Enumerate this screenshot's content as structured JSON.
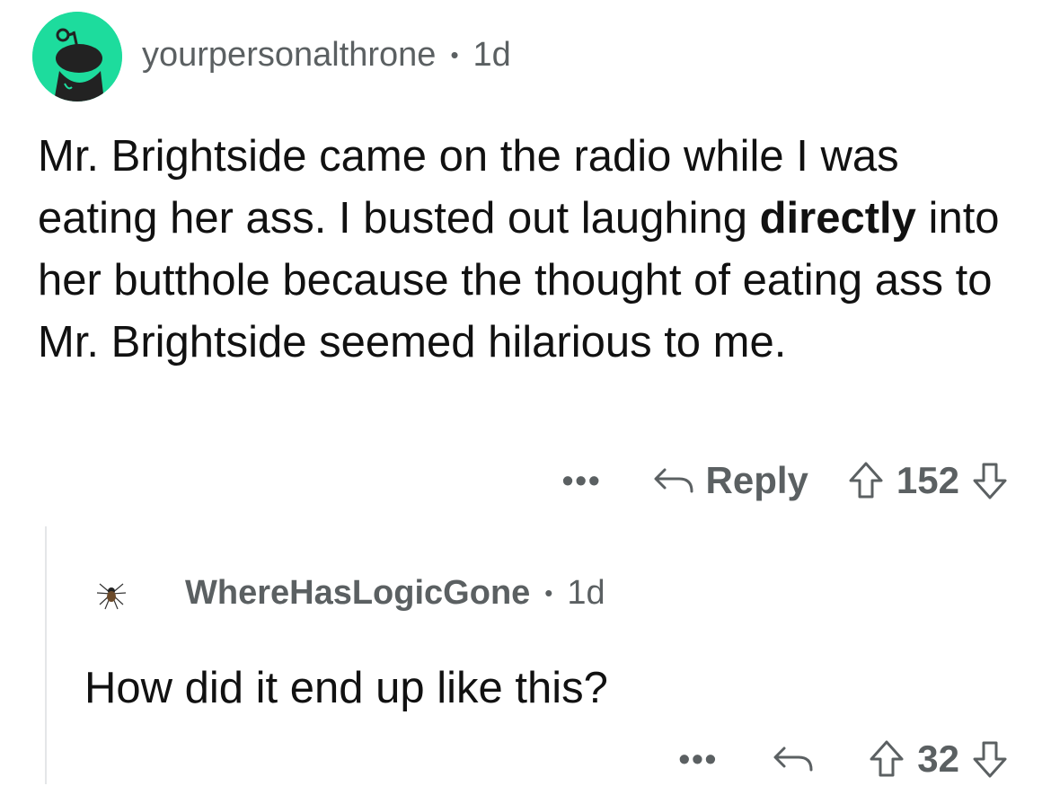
{
  "comment": {
    "username": "yourpersonalthrone",
    "separator": "•",
    "age": "1d",
    "avatar_icon": "reddit-snoo-avatar",
    "avatar_color": "#1ddc9d",
    "text_part1": "Mr. Brightside came on the radio while I was eating her ass. I busted out laughing ",
    "text_bold": "directly",
    "text_part2": " into her butthole because the thought of eating ass to Mr. Brightside seemed hilarious to me.",
    "more_label": "•••",
    "reply_label": "Reply",
    "reply_icon": "reply-arrow-icon",
    "score": "152"
  },
  "reply": {
    "username": "WhereHasLogicGone",
    "separator": "•",
    "age": "1d",
    "avatar_icon": "spider-avatar",
    "text": "How did it end up like this?",
    "more_label": "•••",
    "reply_icon": "reply-arrow-icon",
    "score": "32"
  },
  "colors": {
    "meta_text": "#5b6062",
    "body_text": "#111111",
    "thread_line": "#e4e6e8"
  }
}
